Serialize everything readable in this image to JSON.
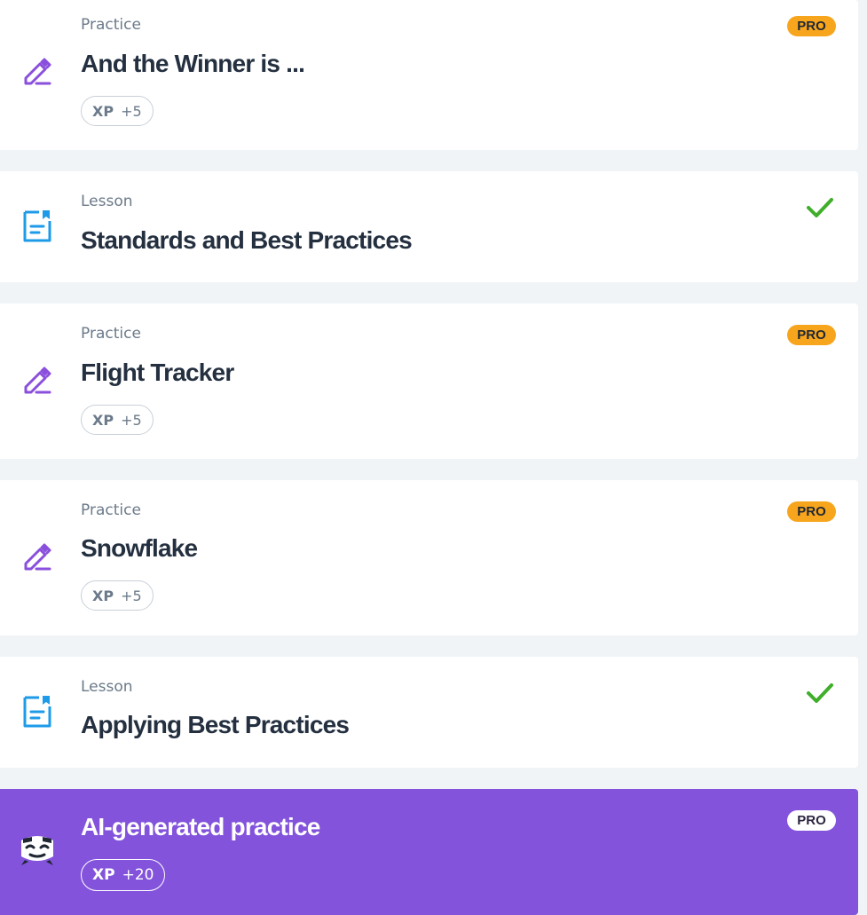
{
  "items": [
    {
      "type": "Practice",
      "title": "And the Winner is ...",
      "xp_label": "XP",
      "xp_value": "+5",
      "badge": "PRO",
      "icon": "pencil-icon"
    },
    {
      "type": "Lesson",
      "title": "Standards and Best Practices",
      "status": "completed",
      "icon": "lesson-doc-icon"
    },
    {
      "type": "Practice",
      "title": "Flight Tracker",
      "xp_label": "XP",
      "xp_value": "+5",
      "badge": "PRO",
      "icon": "pencil-icon"
    },
    {
      "type": "Practice",
      "title": "Snowflake",
      "xp_label": "XP",
      "xp_value": "+5",
      "badge": "PRO",
      "icon": "pencil-icon"
    },
    {
      "type": "Lesson",
      "title": "Applying Best Practices",
      "status": "completed",
      "icon": "lesson-doc-icon"
    },
    {
      "title": "AI-generated practice",
      "xp_label": "XP",
      "xp_value": "+20",
      "badge": "PRO",
      "icon": "ai-mascot-icon"
    }
  ],
  "colors": {
    "page_bg": "#f1f4f7",
    "card_bg": "#ffffff",
    "ai_card_bg": "#8353dc",
    "practice_icon": "#8a4fdc",
    "lesson_icon": "#1e9be8",
    "check": "#3fae2a",
    "pro_badge": "#f7a51c",
    "title_text": "#243040",
    "muted_text": "#6b7a8a"
  }
}
